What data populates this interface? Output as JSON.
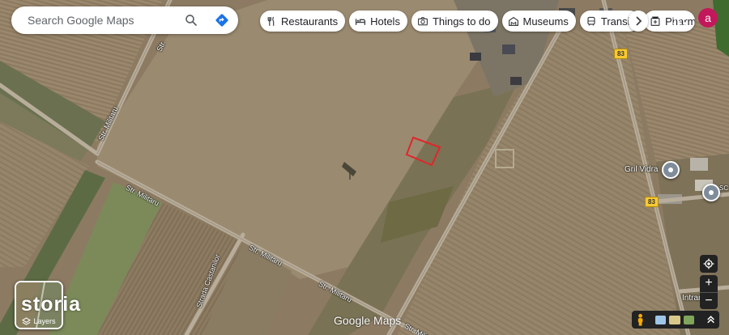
{
  "search": {
    "placeholder": "Search Google Maps"
  },
  "icons": {
    "search": "search-icon",
    "directions": "directions-icon",
    "apps": "apps-grid-icon"
  },
  "chips": [
    {
      "label": "Restaurants",
      "icon": "fork-knife-icon"
    },
    {
      "label": "Hotels",
      "icon": "bed-icon"
    },
    {
      "label": "Things to do",
      "icon": "camera-icon"
    },
    {
      "label": "Museums",
      "icon": "museum-icon"
    },
    {
      "label": "Transit",
      "icon": "bus-icon"
    },
    {
      "label": "Pharmacies",
      "icon": "pharmacy-icon"
    }
  ],
  "account": {
    "initial": "a",
    "color": "#c2185b"
  },
  "streets": {
    "militaru_1": "Str. Militaru",
    "militaru_2": "Str. Militaru",
    "militaru_3": "Str. Militaru",
    "militaru_4": "Str. Militaru",
    "militaru_5": "Str. Militaru",
    "castanilor": "Strada Castanilor",
    "str_top": "Str.",
    "intrare": "Intrar"
  },
  "routes": {
    "r83_top": "83",
    "r83_bottom": "83"
  },
  "places": {
    "gril_vidra": "Gril Vidra",
    "sc_partial": "SC SR"
  },
  "layers": {
    "label": "Layers"
  },
  "watermark": "storia",
  "logo": "Google Maps",
  "controls": {
    "zoom_in": "+",
    "zoom_out": "−"
  },
  "colors": {
    "parcel_outline": "#e0262b",
    "pin": "#7f8c99",
    "route_shield": "#f9c933"
  }
}
